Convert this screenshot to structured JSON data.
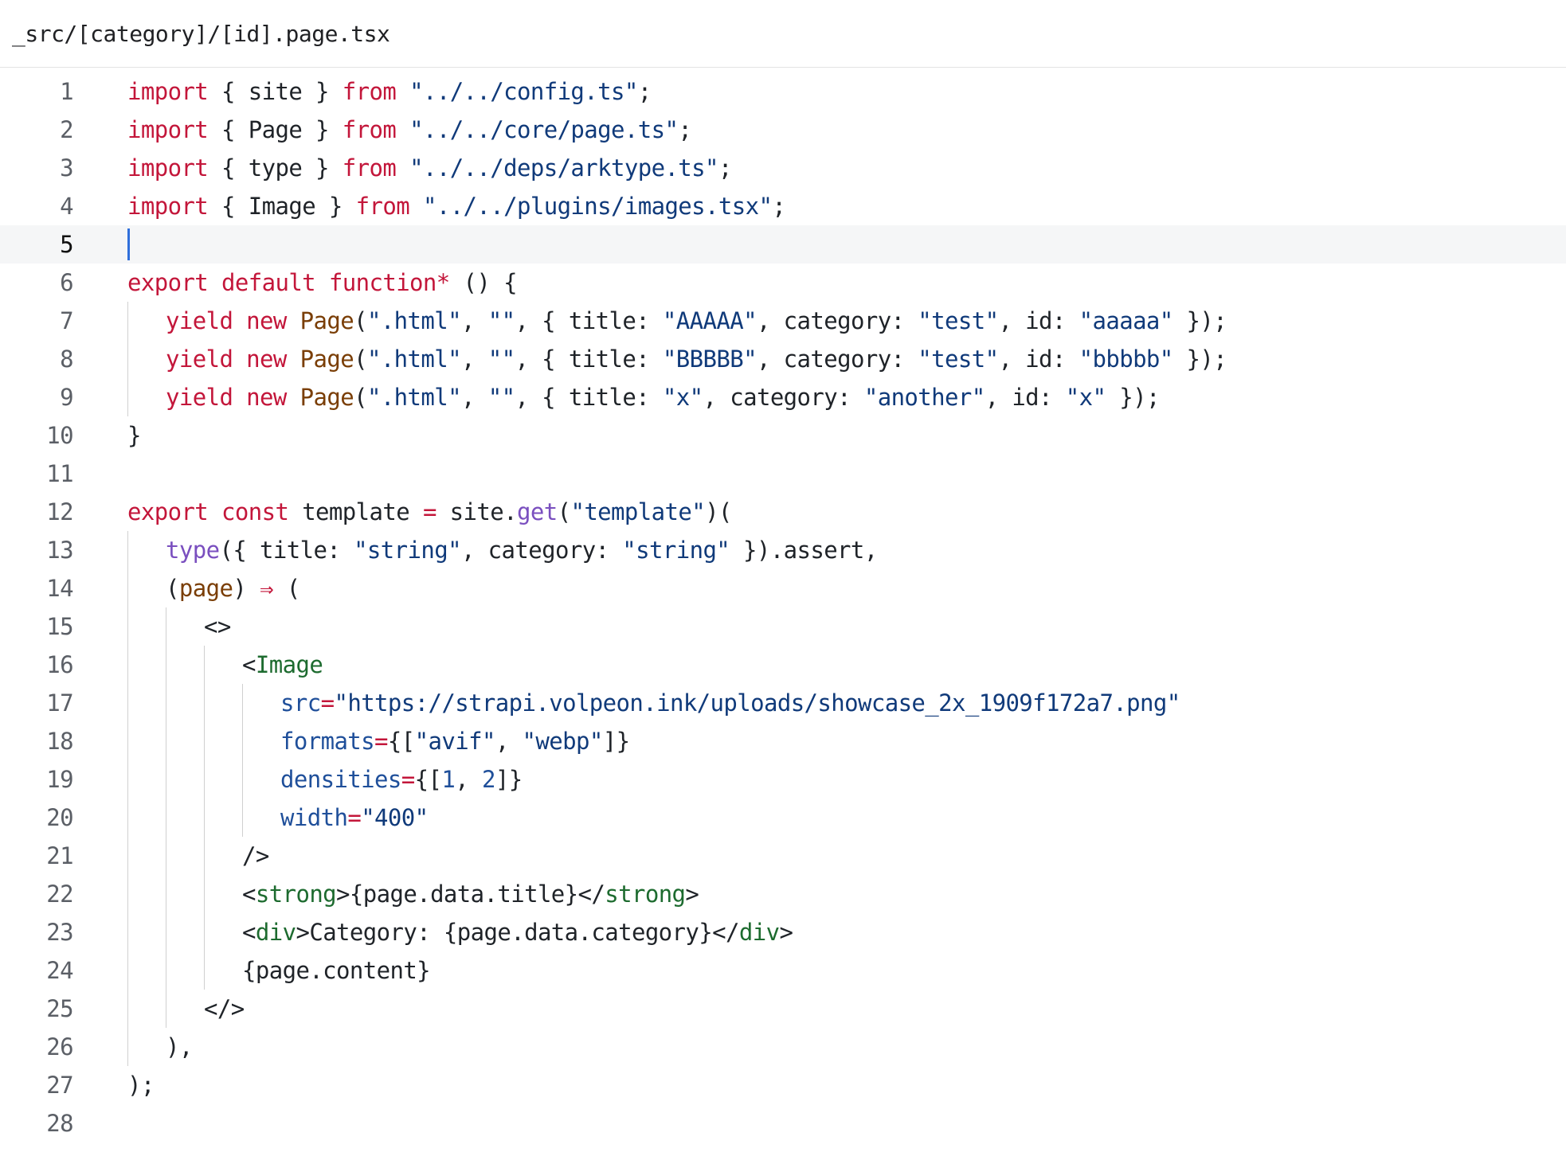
{
  "file": {
    "path": "_src/[category]/[id].page.tsx"
  },
  "editor": {
    "active_line": 5,
    "colors": {
      "keyword": "#c3163a",
      "string": "#103a7a",
      "function": "#7a3e06",
      "call": "#7a4fbf",
      "tag": "#1d6b2f",
      "attribute": "#1f4f9a",
      "caret": "#2f6fdb"
    },
    "lines": [
      {
        "n": "1",
        "indent": 0,
        "tokens": [
          [
            "kw",
            "import"
          ],
          [
            "plain",
            " { site } "
          ],
          [
            "kw",
            "from"
          ],
          [
            "plain",
            " "
          ],
          [
            "str",
            "\"../../config.ts\""
          ],
          [
            "plain",
            ";"
          ]
        ]
      },
      {
        "n": "2",
        "indent": 0,
        "tokens": [
          [
            "kw",
            "import"
          ],
          [
            "plain",
            " { Page } "
          ],
          [
            "kw",
            "from"
          ],
          [
            "plain",
            " "
          ],
          [
            "str",
            "\"../../core/page.ts\""
          ],
          [
            "plain",
            ";"
          ]
        ]
      },
      {
        "n": "3",
        "indent": 0,
        "tokens": [
          [
            "kw",
            "import"
          ],
          [
            "plain",
            " { type } "
          ],
          [
            "kw",
            "from"
          ],
          [
            "plain",
            " "
          ],
          [
            "str",
            "\"../../deps/arktype.ts\""
          ],
          [
            "plain",
            ";"
          ]
        ]
      },
      {
        "n": "4",
        "indent": 0,
        "tokens": [
          [
            "kw",
            "import"
          ],
          [
            "plain",
            " { Image } "
          ],
          [
            "kw",
            "from"
          ],
          [
            "plain",
            " "
          ],
          [
            "str",
            "\"../../plugins/images.tsx\""
          ],
          [
            "plain",
            ";"
          ]
        ]
      },
      {
        "n": "5",
        "indent": 0,
        "tokens": [],
        "caret": true
      },
      {
        "n": "6",
        "indent": 0,
        "tokens": [
          [
            "kw",
            "export default function"
          ],
          [
            "op",
            "*"
          ],
          [
            "plain",
            " () {"
          ]
        ]
      },
      {
        "n": "7",
        "indent": 1,
        "tokens": [
          [
            "kw",
            "yield new"
          ],
          [
            "plain",
            " "
          ],
          [
            "fn",
            "Page"
          ],
          [
            "plain",
            "("
          ],
          [
            "str",
            "\".html\""
          ],
          [
            "plain",
            ", "
          ],
          [
            "str",
            "\"\""
          ],
          [
            "plain",
            ", { title: "
          ],
          [
            "str",
            "\"AAAAA\""
          ],
          [
            "plain",
            ", category: "
          ],
          [
            "str",
            "\"test\""
          ],
          [
            "plain",
            ", id: "
          ],
          [
            "str",
            "\"aaaaa\""
          ],
          [
            "plain",
            " });"
          ]
        ]
      },
      {
        "n": "8",
        "indent": 1,
        "tokens": [
          [
            "kw",
            "yield new"
          ],
          [
            "plain",
            " "
          ],
          [
            "fn",
            "Page"
          ],
          [
            "plain",
            "("
          ],
          [
            "str",
            "\".html\""
          ],
          [
            "plain",
            ", "
          ],
          [
            "str",
            "\"\""
          ],
          [
            "plain",
            ", { title: "
          ],
          [
            "str",
            "\"BBBBB\""
          ],
          [
            "plain",
            ", category: "
          ],
          [
            "str",
            "\"test\""
          ],
          [
            "plain",
            ", id: "
          ],
          [
            "str",
            "\"bbbbb\""
          ],
          [
            "plain",
            " });"
          ]
        ]
      },
      {
        "n": "9",
        "indent": 1,
        "tokens": [
          [
            "kw",
            "yield new"
          ],
          [
            "plain",
            " "
          ],
          [
            "fn",
            "Page"
          ],
          [
            "plain",
            "("
          ],
          [
            "str",
            "\".html\""
          ],
          [
            "plain",
            ", "
          ],
          [
            "str",
            "\"\""
          ],
          [
            "plain",
            ", { title: "
          ],
          [
            "str",
            "\"x\""
          ],
          [
            "plain",
            ", category: "
          ],
          [
            "str",
            "\"another\""
          ],
          [
            "plain",
            ", id: "
          ],
          [
            "str",
            "\"x\""
          ],
          [
            "plain",
            " });"
          ]
        ]
      },
      {
        "n": "10",
        "indent": 0,
        "tokens": [
          [
            "plain",
            "}"
          ]
        ]
      },
      {
        "n": "11",
        "indent": 0,
        "tokens": []
      },
      {
        "n": "12",
        "indent": 0,
        "tokens": [
          [
            "kw",
            "export const"
          ],
          [
            "plain",
            " template "
          ],
          [
            "op",
            "="
          ],
          [
            "plain",
            " site."
          ],
          [
            "call",
            "get"
          ],
          [
            "plain",
            "("
          ],
          [
            "str",
            "\"template\""
          ],
          [
            "plain",
            ")("
          ]
        ]
      },
      {
        "n": "13",
        "indent": 1,
        "tokens": [
          [
            "call",
            "type"
          ],
          [
            "plain",
            "({ title: "
          ],
          [
            "str",
            "\"string\""
          ],
          [
            "plain",
            ", category: "
          ],
          [
            "str",
            "\"string\""
          ],
          [
            "plain",
            " }).assert,"
          ]
        ]
      },
      {
        "n": "14",
        "indent": 1,
        "tokens": [
          [
            "plain",
            "("
          ],
          [
            "param",
            "page"
          ],
          [
            "plain",
            ") "
          ],
          [
            "op",
            "⇒"
          ],
          [
            "plain",
            " ("
          ]
        ]
      },
      {
        "n": "15",
        "indent": 2,
        "tokens": [
          [
            "plain",
            "<>"
          ]
        ]
      },
      {
        "n": "16",
        "indent": 3,
        "tokens": [
          [
            "plain",
            "<"
          ],
          [
            "tag",
            "Image"
          ]
        ]
      },
      {
        "n": "17",
        "indent": 4,
        "tokens": [
          [
            "attr",
            "src"
          ],
          [
            "op",
            "="
          ],
          [
            "str",
            "\"https://strapi.volpeon.ink/uploads/showcase_2x_1909f172a7.png\""
          ]
        ]
      },
      {
        "n": "18",
        "indent": 4,
        "tokens": [
          [
            "attr",
            "formats"
          ],
          [
            "op",
            "="
          ],
          [
            "plain",
            "{["
          ],
          [
            "str",
            "\"avif\""
          ],
          [
            "plain",
            ", "
          ],
          [
            "str",
            "\"webp\""
          ],
          [
            "plain",
            "]}"
          ]
        ]
      },
      {
        "n": "19",
        "indent": 4,
        "tokens": [
          [
            "attr",
            "densities"
          ],
          [
            "op",
            "="
          ],
          [
            "plain",
            "{["
          ],
          [
            "num",
            "1"
          ],
          [
            "plain",
            ", "
          ],
          [
            "num",
            "2"
          ],
          [
            "plain",
            "]}"
          ]
        ]
      },
      {
        "n": "20",
        "indent": 4,
        "tokens": [
          [
            "attr",
            "width"
          ],
          [
            "op",
            "="
          ],
          [
            "str",
            "\"400\""
          ]
        ]
      },
      {
        "n": "21",
        "indent": 3,
        "tokens": [
          [
            "plain",
            "/>"
          ]
        ]
      },
      {
        "n": "22",
        "indent": 3,
        "tokens": [
          [
            "plain",
            "<"
          ],
          [
            "tag",
            "strong"
          ],
          [
            "plain",
            ">{page.data.title}</"
          ],
          [
            "tag",
            "strong"
          ],
          [
            "plain",
            ">"
          ]
        ]
      },
      {
        "n": "23",
        "indent": 3,
        "tokens": [
          [
            "plain",
            "<"
          ],
          [
            "tag",
            "div"
          ],
          [
            "plain",
            ">Category: {page.data.category}</"
          ],
          [
            "tag",
            "div"
          ],
          [
            "plain",
            ">"
          ]
        ]
      },
      {
        "n": "24",
        "indent": 3,
        "tokens": [
          [
            "plain",
            "{page.content}"
          ]
        ]
      },
      {
        "n": "25",
        "indent": 2,
        "tokens": [
          [
            "plain",
            "</>"
          ]
        ]
      },
      {
        "n": "26",
        "indent": 1,
        "tokens": [
          [
            "plain",
            "),"
          ]
        ]
      },
      {
        "n": "27",
        "indent": 0,
        "tokens": [
          [
            "plain",
            ");"
          ]
        ]
      },
      {
        "n": "28",
        "indent": 0,
        "tokens": []
      }
    ]
  }
}
